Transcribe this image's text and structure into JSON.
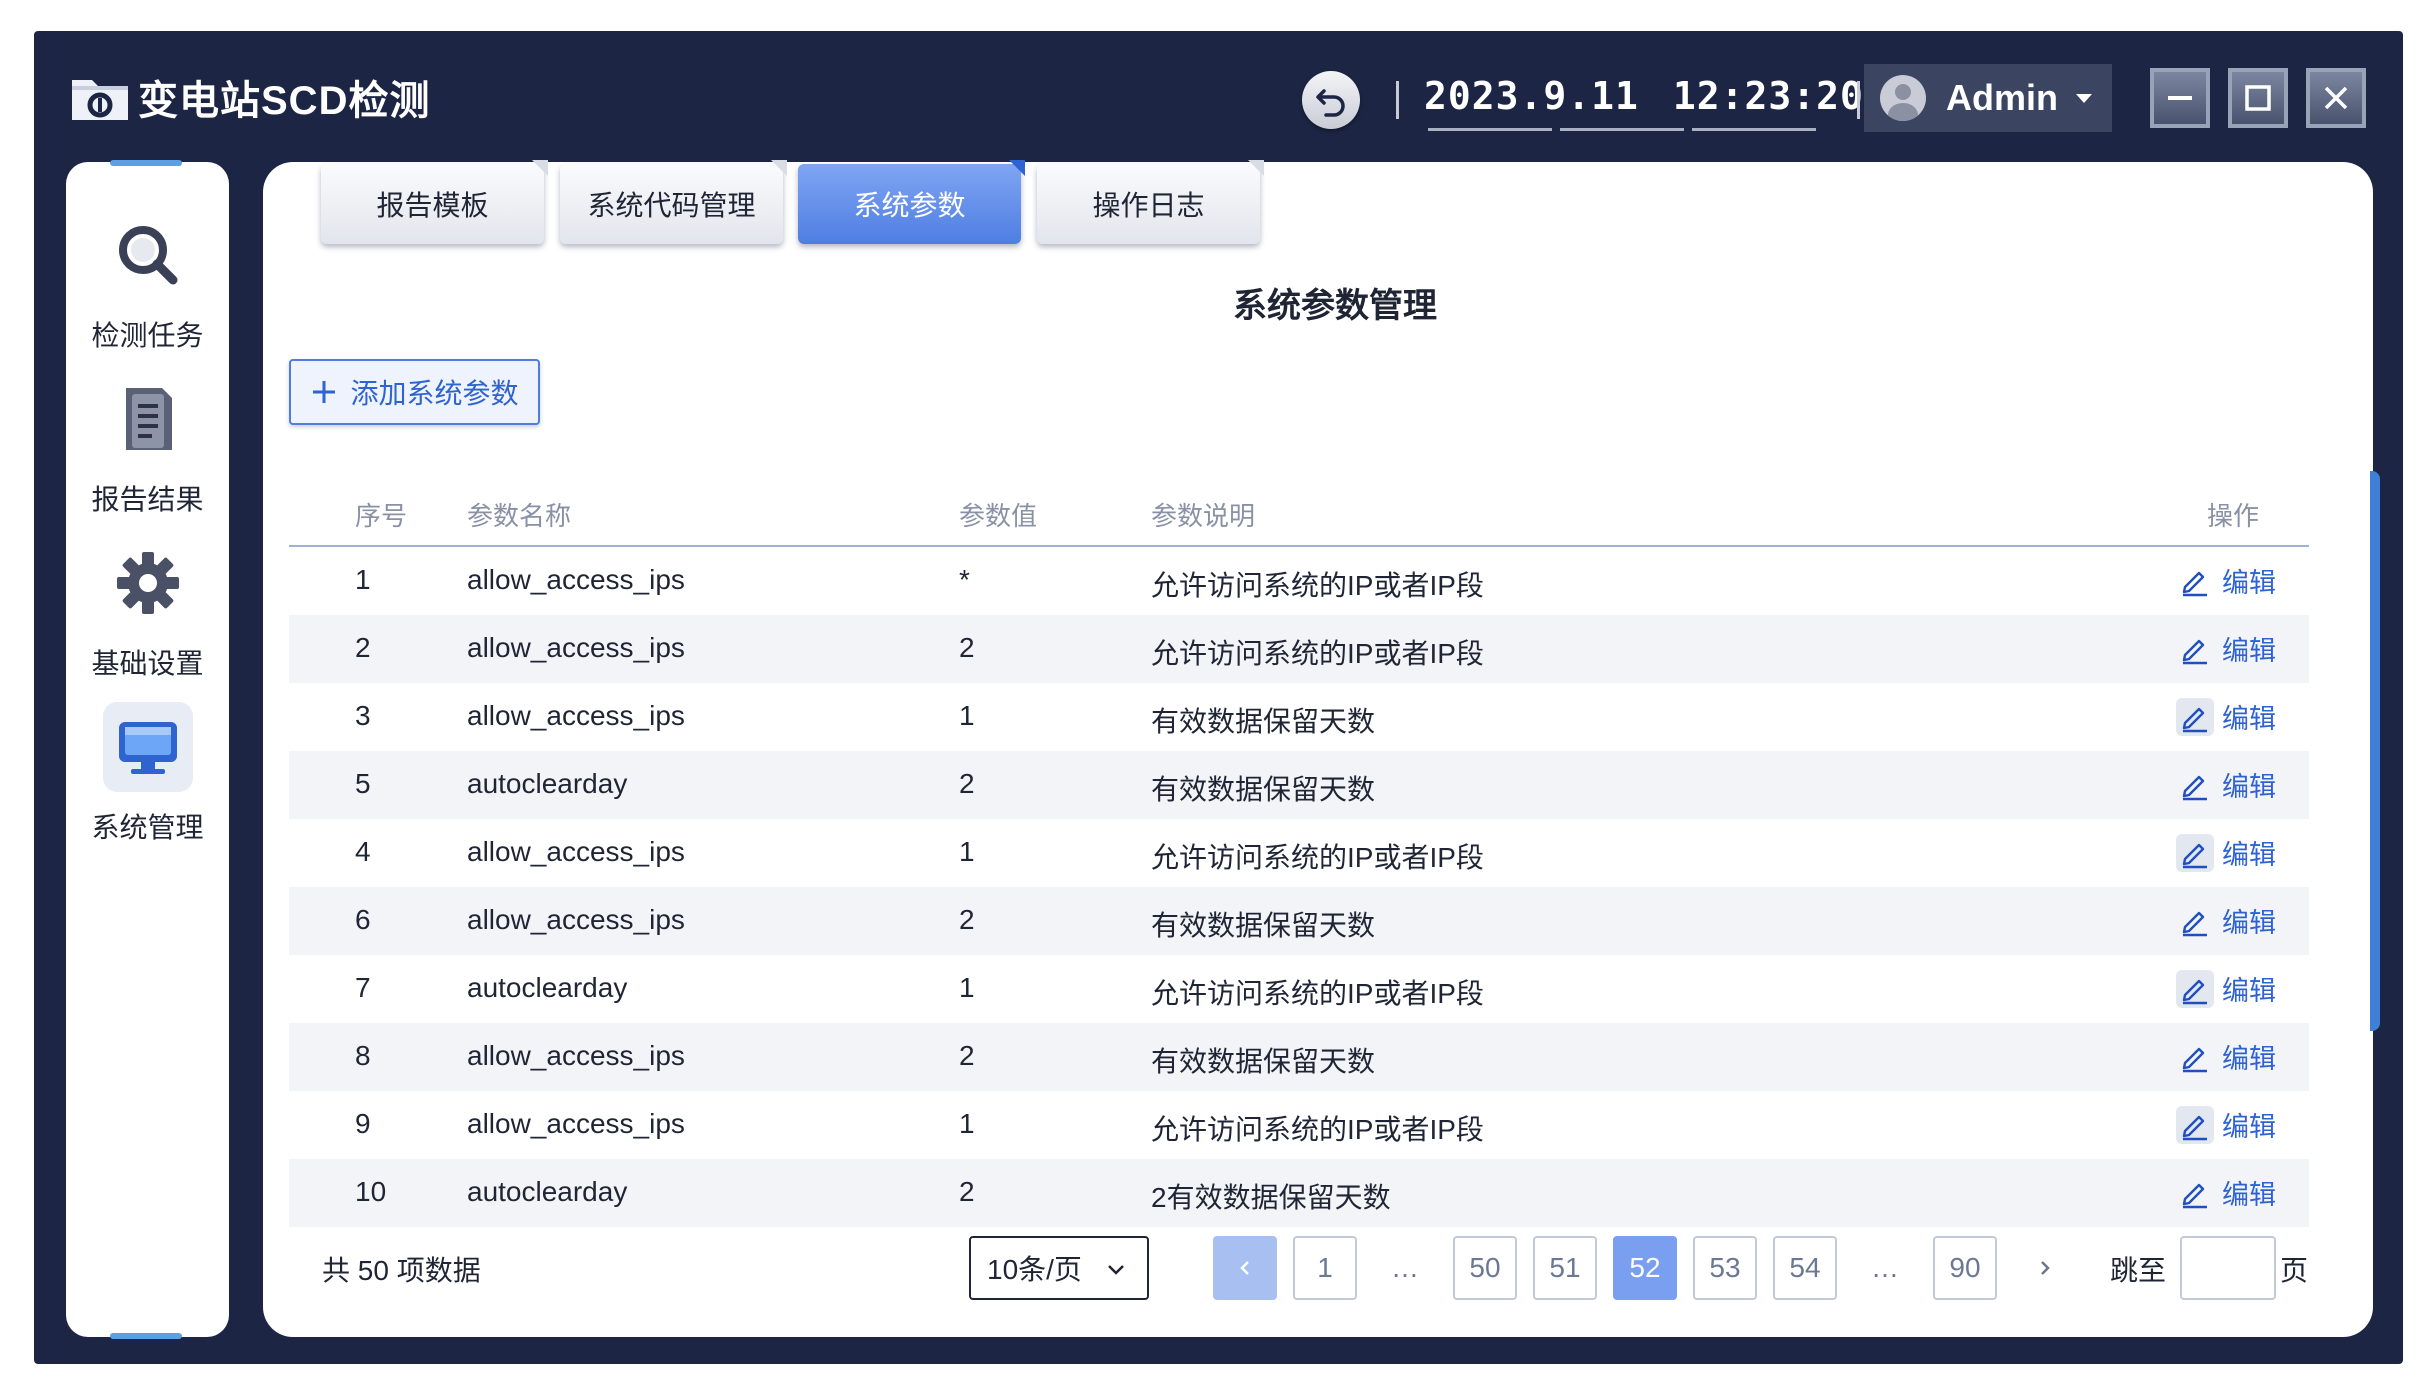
{
  "app": {
    "title": "变电站SCD检测"
  },
  "header": {
    "date": "2023.9.11",
    "time": "12:23:20",
    "user": "Admin"
  },
  "sidebar": {
    "items": [
      {
        "label": "检测任务",
        "icon": "search-icon",
        "active": false
      },
      {
        "label": "报告结果",
        "icon": "document-icon",
        "active": false
      },
      {
        "label": "基础设置",
        "icon": "gear-icon",
        "active": false
      },
      {
        "label": "系统管理",
        "icon": "monitor-icon",
        "active": true
      }
    ]
  },
  "tabs": [
    {
      "label": "报告模板",
      "active": false
    },
    {
      "label": "系统代码管理",
      "active": false
    },
    {
      "label": "系统参数",
      "active": true
    },
    {
      "label": "操作日志",
      "active": false
    }
  ],
  "main": {
    "title": "系统参数管理",
    "add_button": "添加系统参数"
  },
  "table": {
    "columns": [
      "序号",
      "参数名称",
      "参数值",
      "参数说明",
      "操作"
    ],
    "rows": [
      {
        "no": "1",
        "name": "allow_access_ips",
        "value": "*",
        "desc": "允许访问系统的IP或者IP段",
        "action": "编辑"
      },
      {
        "no": "2",
        "name": "allow_access_ips",
        "value": "2",
        "desc": "允许访问系统的IP或者IP段",
        "action": "编辑"
      },
      {
        "no": "3",
        "name": "allow_access_ips",
        "value": "1",
        "desc": "有效数据保留天数",
        "action": "编辑"
      },
      {
        "no": "5",
        "name": "autoclearday",
        "value": "2",
        "desc": "有效数据保留天数",
        "action": "编辑"
      },
      {
        "no": "4",
        "name": "allow_access_ips",
        "value": "1",
        "desc": "允许访问系统的IP或者IP段",
        "action": "编辑"
      },
      {
        "no": "6",
        "name": "allow_access_ips",
        "value": "2",
        "desc": "有效数据保留天数",
        "action": "编辑"
      },
      {
        "no": "7",
        "name": "autoclearday",
        "value": "1",
        "desc": "允许访问系统的IP或者IP段",
        "action": "编辑"
      },
      {
        "no": "8",
        "name": "allow_access_ips",
        "value": "2",
        "desc": "有效数据保留天数",
        "action": "编辑"
      },
      {
        "no": "9",
        "name": "allow_access_ips",
        "value": "1",
        "desc": "允许访问系统的IP或者IP段",
        "action": "编辑"
      },
      {
        "no": "10",
        "name": "autoclearday",
        "value": "2",
        "desc": "2有效数据保留天数",
        "action": "编辑"
      }
    ]
  },
  "pagination": {
    "total": "共 50 项数据",
    "page_size": "10条/页",
    "pages": [
      "1",
      "…",
      "50",
      "51",
      "52",
      "53",
      "54",
      "…",
      "90"
    ],
    "current": "52",
    "jump_label": "跳至",
    "jump_suffix": "页"
  },
  "colors": {
    "frame": "#1c2644",
    "accent": "#4f7ee2",
    "active_page": "#7a9ef0",
    "row_alt": "#f3f4f7"
  }
}
